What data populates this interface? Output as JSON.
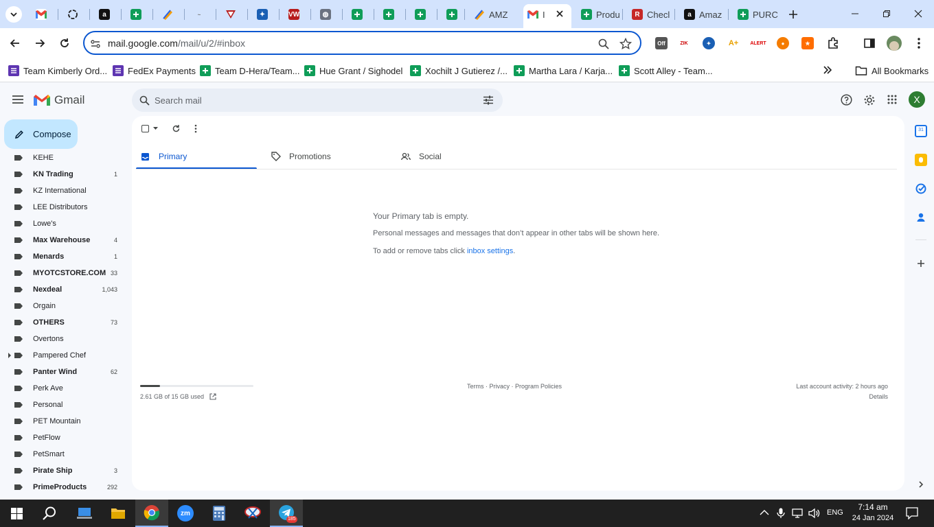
{
  "browser": {
    "tabs": [
      {
        "title": "",
        "icon": "gmail-icon"
      },
      {
        "title": "",
        "icon": "openai-icon"
      },
      {
        "title": "",
        "icon": "amazon-icon"
      },
      {
        "title": "",
        "icon": "sheets-icon"
      },
      {
        "title": "",
        "icon": "pencil-app-icon"
      },
      {
        "title": "",
        "icon": "generic-site-icon"
      },
      {
        "title": "",
        "icon": "triangle-site-icon"
      },
      {
        "title": "",
        "icon": "wheel-icon"
      },
      {
        "title": "",
        "icon": "vw-icon"
      },
      {
        "title": "",
        "icon": "globe-icon"
      },
      {
        "title": "",
        "icon": "sheets-icon"
      },
      {
        "title": "",
        "icon": "sheets-icon"
      },
      {
        "title": "",
        "icon": "sheets-icon"
      },
      {
        "title": "",
        "icon": "sheets-icon"
      },
      {
        "title": "AMZ",
        "icon": "pencil-app-icon"
      },
      {
        "title": "I",
        "icon": "gmail-icon",
        "active": true
      },
      {
        "title": "Produ",
        "icon": "sheets-icon"
      },
      {
        "title": "Checl",
        "icon": "red-circle-icon"
      },
      {
        "title": "Amaz",
        "icon": "amazon-icon"
      },
      {
        "title": "PURC",
        "icon": "sheets-icon"
      }
    ],
    "url_host": "mail.google.com",
    "url_path": "/mail/u/2/#inbox",
    "bookmarks": [
      {
        "label": "Team Kimberly Ord...",
        "icon": "purple-list-icon"
      },
      {
        "label": "FedEx Payments",
        "icon": "purple-list-icon"
      },
      {
        "label": "Team D-Hera/Team...",
        "icon": "sheets-icon"
      },
      {
        "label": "Hue Grant / Sighodel",
        "icon": "sheets-icon"
      },
      {
        "label": "Xochilt J Gutierez /...",
        "icon": "sheets-icon"
      },
      {
        "label": "Martha Lara / Karja...",
        "icon": "sheets-icon"
      },
      {
        "label": "Scott Alley - Team...",
        "icon": "sheets-icon"
      }
    ],
    "all_bookmarks": "All Bookmarks"
  },
  "gmail": {
    "product": "Gmail",
    "search_placeholder": "Search mail",
    "compose": "Compose",
    "avatar_letter": "X",
    "labels": [
      {
        "name": "KEHE",
        "count": "",
        "bold": false
      },
      {
        "name": "KN Trading",
        "count": "1",
        "bold": true
      },
      {
        "name": "KZ International",
        "count": "",
        "bold": false
      },
      {
        "name": "LEE Distributors",
        "count": "",
        "bold": false
      },
      {
        "name": "Lowe's",
        "count": "",
        "bold": false
      },
      {
        "name": "Max Warehouse",
        "count": "4",
        "bold": true
      },
      {
        "name": "Menards",
        "count": "1",
        "bold": true
      },
      {
        "name": "MYOTCSTORE.COM",
        "count": "33",
        "bold": true
      },
      {
        "name": "Nexdeal",
        "count": "1,043",
        "bold": true
      },
      {
        "name": "Orgain",
        "count": "",
        "bold": false
      },
      {
        "name": "OTHERS",
        "count": "73",
        "bold": true
      },
      {
        "name": "Overtons",
        "count": "",
        "bold": false
      },
      {
        "name": "Pampered Chef",
        "count": "",
        "bold": false,
        "expandable": true
      },
      {
        "name": "Panter Wind",
        "count": "62",
        "bold": true
      },
      {
        "name": "Perk Ave",
        "count": "",
        "bold": false
      },
      {
        "name": "Personal",
        "count": "",
        "bold": false
      },
      {
        "name": "PET Mountain",
        "count": "",
        "bold": false
      },
      {
        "name": "PetFlow",
        "count": "",
        "bold": false
      },
      {
        "name": "PetSmart",
        "count": "",
        "bold": false
      },
      {
        "name": "Pirate Ship",
        "count": "3",
        "bold": true
      },
      {
        "name": "PrimeProducts",
        "count": "292",
        "bold": true
      }
    ],
    "tabs": {
      "primary": "Primary",
      "promotions": "Promotions",
      "social": "Social"
    },
    "empty": {
      "title": "Your Primary tab is empty.",
      "line1": "Personal messages and messages that don’t appear in other tabs will be shown here.",
      "line2_prefix": "To add or remove tabs click ",
      "line2_link": "inbox settings",
      "line2_suffix": "."
    },
    "footer": {
      "storage": "2.61 GB of 15 GB used",
      "storage_fraction": 0.174,
      "terms": "Terms",
      "privacy": "Privacy",
      "policies": "Program Policies",
      "sep": " · ",
      "activity": "Last account activity: 2 hours ago",
      "details": "Details"
    }
  },
  "taskbar": {
    "lang": "ENG",
    "time": "7:14 am",
    "date": "24 Jan 2024",
    "telegram_badge": "185"
  },
  "colors": {
    "accent": "#0b57d0",
    "compose": "#c2e7ff",
    "tabstrip": "#d3e3fd",
    "sheets": "#0f9d58"
  }
}
